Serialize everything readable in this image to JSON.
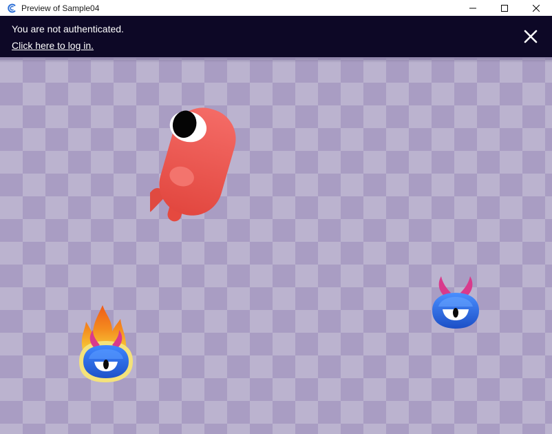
{
  "window": {
    "title": "Preview of Sample04",
    "icon": "app-icon",
    "controls": [
      "minimize-icon",
      "maximize-icon",
      "close-icon"
    ]
  },
  "auth_banner": {
    "message": "You are not authenticated.",
    "link_text": "Click here to log in.",
    "close_icon": "close-icon",
    "background": "#0d0826"
  },
  "game": {
    "background_pattern": "checkerboard",
    "colors": {
      "light": "#bbb3cf",
      "dark": "#a99dc3"
    },
    "sprites": [
      {
        "name": "red-one-eyed-monster",
        "color": "#ee4a45"
      },
      {
        "name": "flaming-blue-horned-monster",
        "color": "#2f6ff0"
      },
      {
        "name": "blue-horned-monster",
        "color": "#2f6ff0"
      }
    ]
  }
}
